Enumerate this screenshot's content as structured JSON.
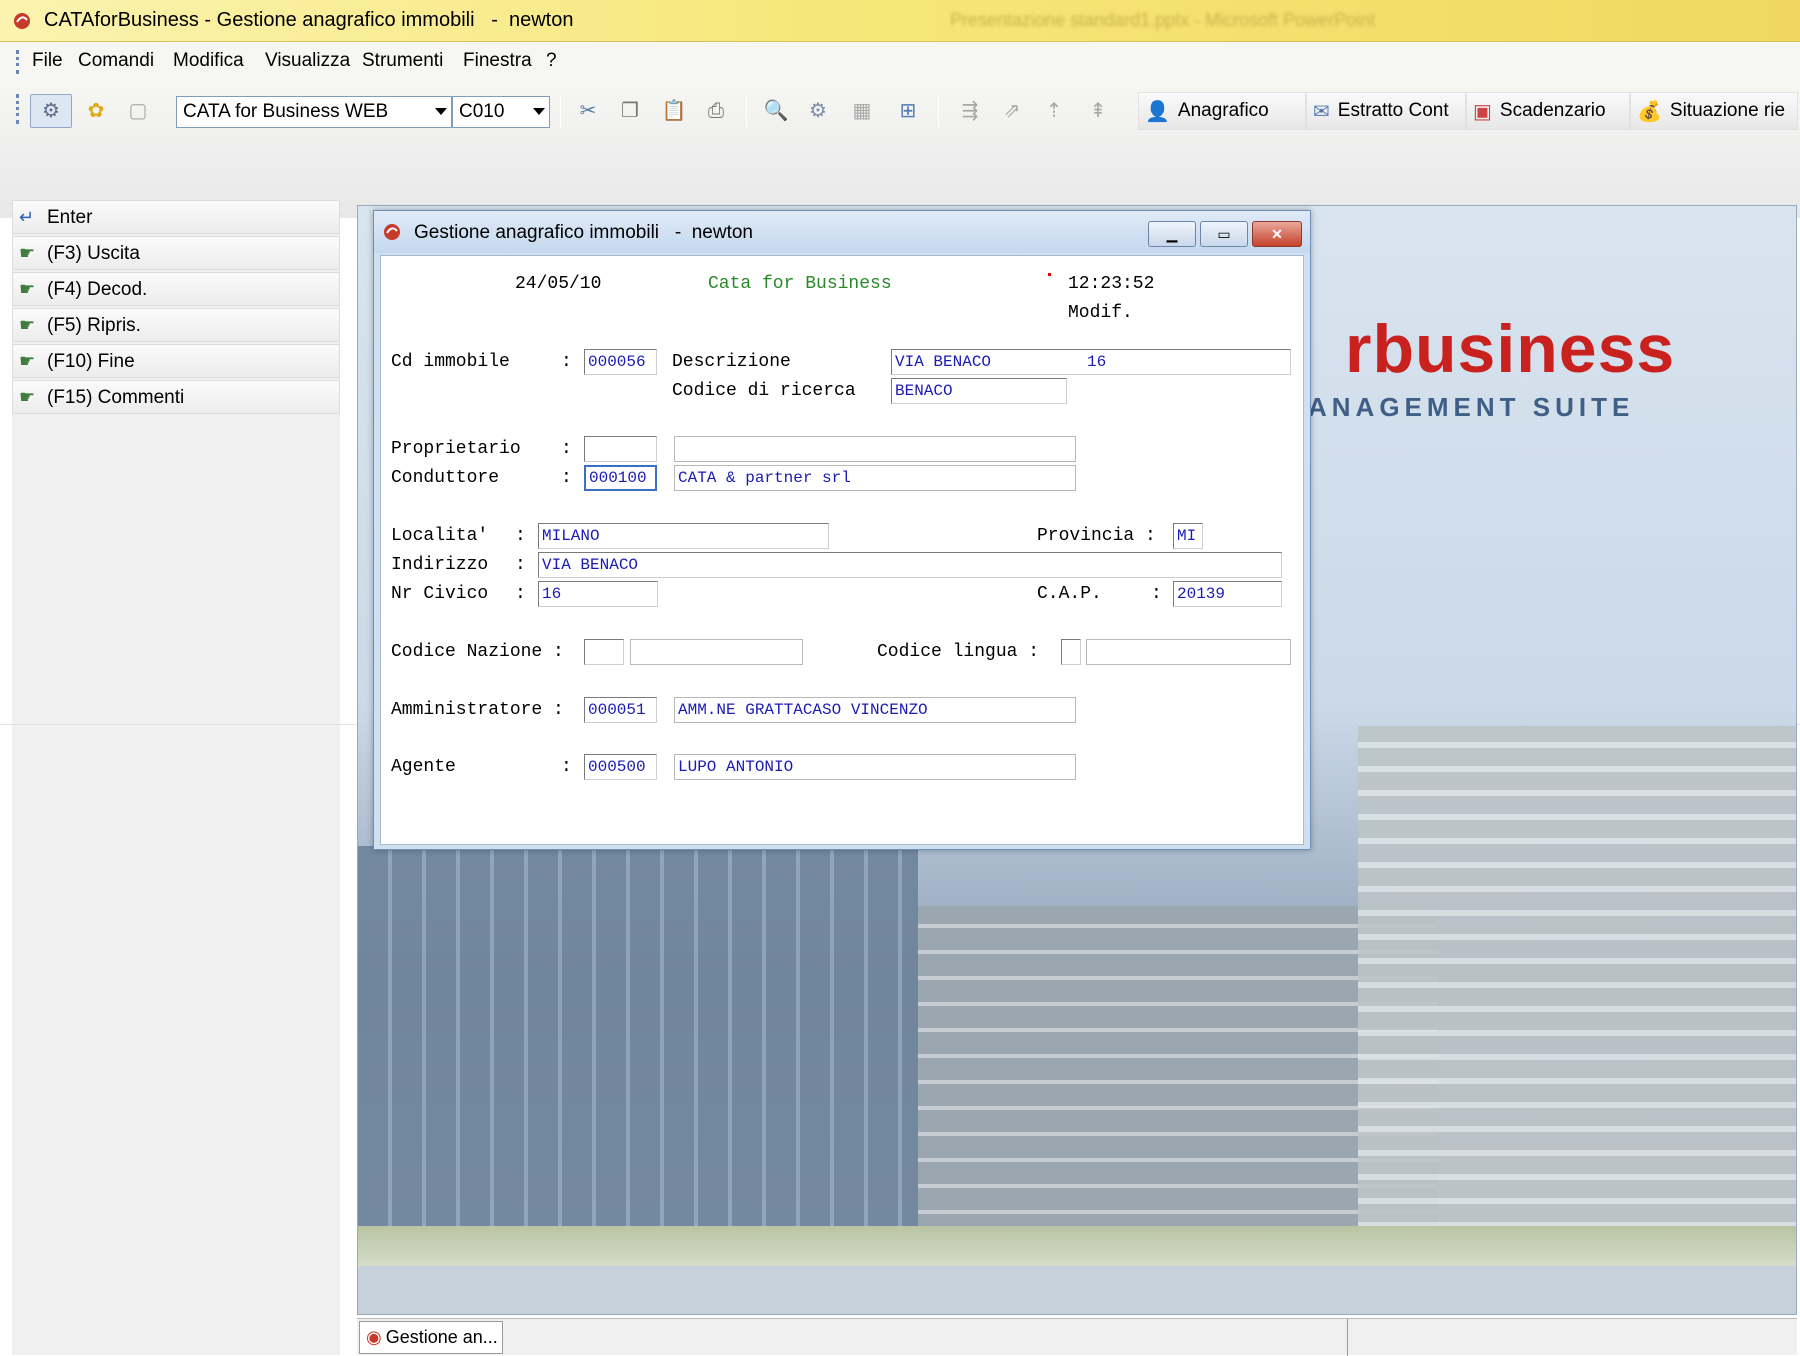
{
  "window": {
    "title": "CATAforBusiness - Gestione anagrafico immobili   -  newton",
    "background_title": "Presentazione standard1.pptx - Microsoft PowerPoint"
  },
  "menu": [
    "File",
    "Comandi",
    "Modifica",
    "Visualizza",
    "Strumenti",
    "Finestra",
    "?"
  ],
  "toolbar": {
    "combo1": "CATA for Business WEB",
    "combo2": "C010",
    "buttons": [
      "Anagrafico",
      "Estratto Cont",
      "Scadenzario",
      "Situazione rie"
    ],
    "icons": [
      "connect-icon",
      "star-icon",
      "blank-page-icon",
      "cut-icon",
      "copy-icon",
      "paste-icon",
      "print-icon",
      "preview-icon",
      "settings-icon",
      "chart-icon",
      "network-icon",
      "tool-a-icon",
      "tool-b-icon",
      "tool-c-icon",
      "tool-d-icon"
    ]
  },
  "left_panel": [
    "Enter",
    "(F3) Uscita",
    "(F4) Decod.",
    "(F5) Ripris.",
    "(F10) Fine",
    "(F15) Commenti"
  ],
  "background": {
    "logo_word": "rbusiness",
    "logo_sub": "ANAGEMENT SUITE"
  },
  "taskbar": {
    "tab": "Gestione an..."
  },
  "dialog": {
    "title": "Gestione anagrafico immobili   -  newton",
    "date": "24/05/10",
    "app_name": "Cata for Business",
    "time": "12:23:52",
    "mode": "Modif.",
    "labels": {
      "cd_immobile": "Cd immobile",
      "descrizione": "Descrizione",
      "codice_ricerca": "Codice di ricerca",
      "proprietario": "Proprietario",
      "conduttore": "Conduttore",
      "localita": "Localita'",
      "provincia": "Provincia :",
      "indirizzo": "Indirizzo",
      "nr_civico": "Nr Civico",
      "cap": "C.A.P.",
      "codice_nazione": "Codice Nazione :",
      "codice_lingua": "Codice lingua :",
      "amministratore": "Amministratore :",
      "agente": "Agente"
    },
    "values": {
      "cd_immobile": "000056",
      "descrizione": "VIA BENACO          16",
      "codice_ricerca": "BENACO",
      "proprietario_code": "",
      "proprietario_name": "",
      "conduttore_code": "000100",
      "conduttore_name": "CATA & partner srl",
      "localita": "MILANO",
      "provincia": "MI",
      "indirizzo": "VIA BENACO",
      "nr_civico": "16",
      "cap": "20139",
      "codice_nazione_code": "",
      "codice_nazione_name": "",
      "codice_lingua_code": "",
      "codice_lingua_name": "",
      "amministratore_code": "000051",
      "amministratore_name": "AMM.NE GRATTACASO VINCENZO",
      "agente_code": "000500",
      "agente_name": "LUPO ANTONIO"
    }
  },
  "colors": {
    "title_yellow": "#f7e77a",
    "logo_red": "#c8211e",
    "field_text": "#1a1ab5",
    "app_name_green": "#2a8a2a"
  }
}
